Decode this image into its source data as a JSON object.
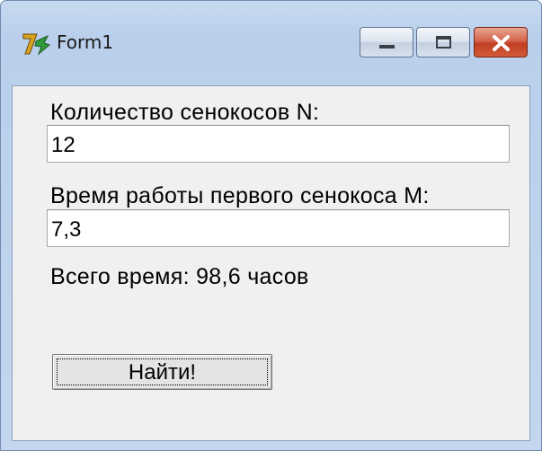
{
  "window": {
    "title": "Form1"
  },
  "form": {
    "label_n": "Количество сенокосов N:",
    "value_n": "12",
    "label_m": "Время работы первого сенокоса M:",
    "value_m": "7,3",
    "result": "Всего время: 98,6 часов",
    "button_label": "Найти!"
  }
}
